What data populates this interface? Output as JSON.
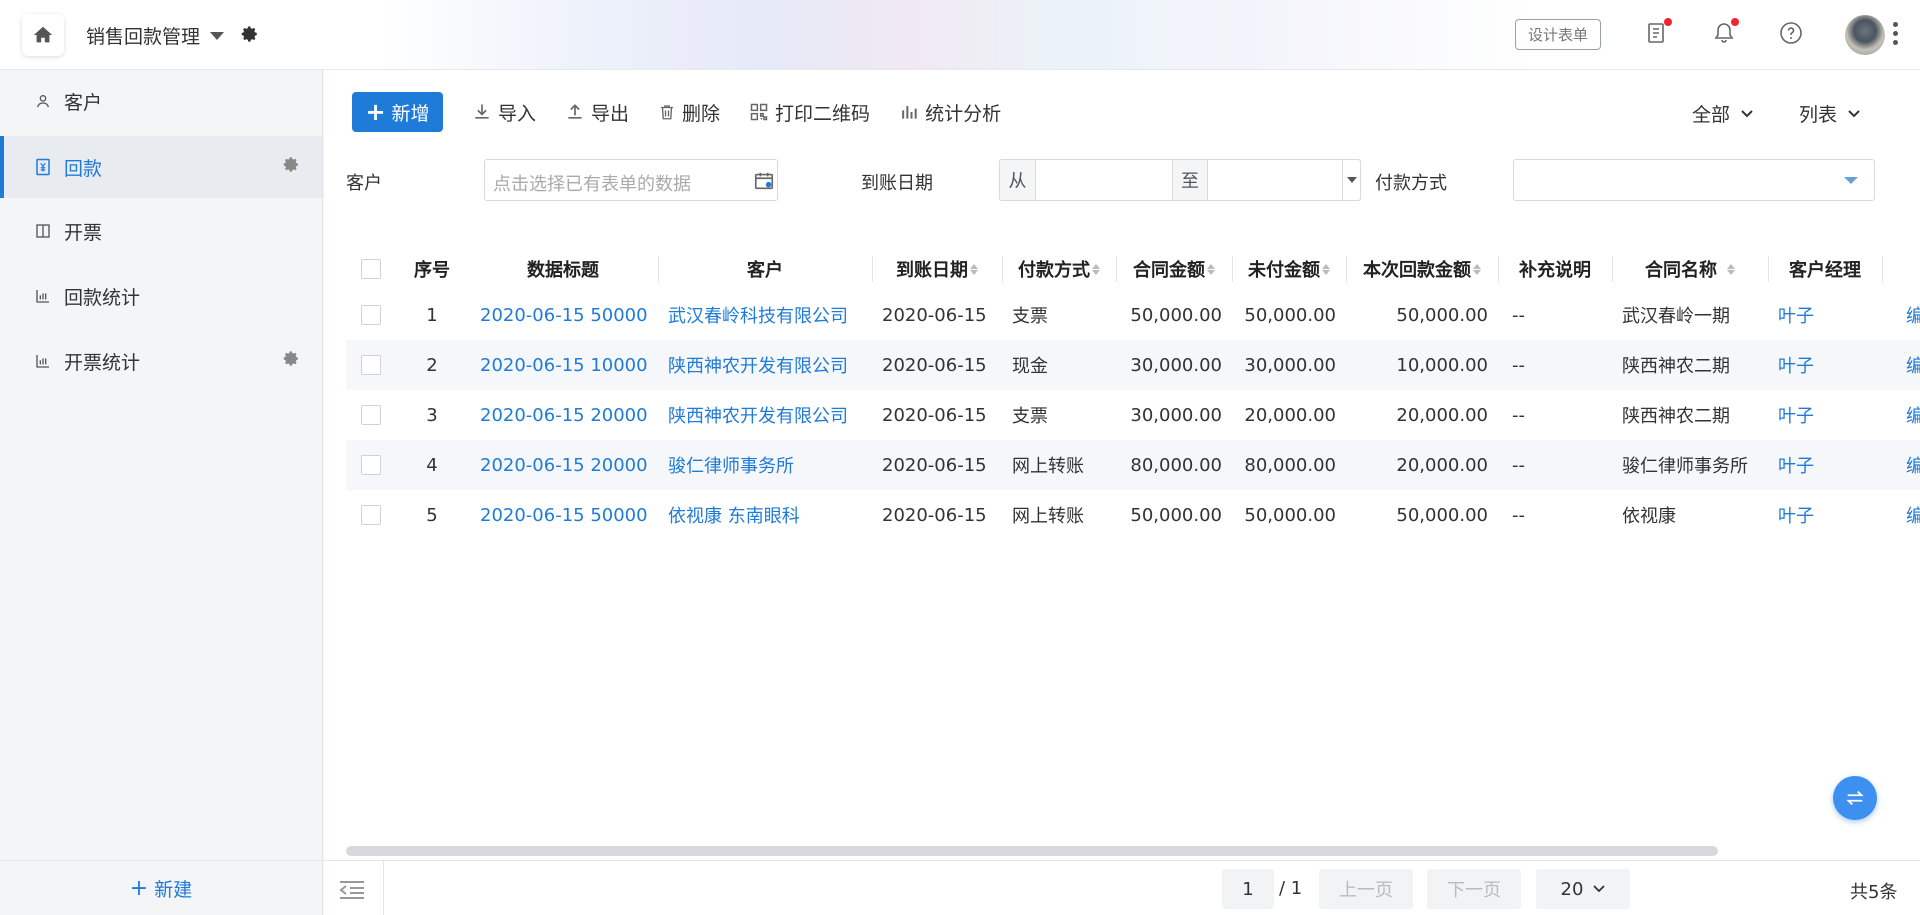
{
  "header": {
    "app_title": "销售回款管理",
    "design_form_label": "设计表单",
    "icons": [
      "home-icon",
      "gear-icon",
      "task-icon",
      "bell-icon",
      "help-icon"
    ],
    "accent_color": "#1f7bd8",
    "badge_color": "#f5222d"
  },
  "sidebar": {
    "items": [
      {
        "label": "客户",
        "icon": "person-icon"
      },
      {
        "label": "回款",
        "icon": "yen-doc-icon"
      },
      {
        "label": "开票",
        "icon": "invoice-icon"
      },
      {
        "label": "回款统计",
        "icon": "bar-chart-icon"
      },
      {
        "label": "开票统计",
        "icon": "bar-chart-icon"
      }
    ],
    "active_item": "回款",
    "new_label": "新建"
  },
  "toolbar": {
    "add_label": "新增",
    "import_label": "导入",
    "export_label": "导出",
    "delete_label": "删除",
    "print_qr_label": "打印二维码",
    "stats_label": "统计分析",
    "filter_scope": "全部",
    "view_mode": "列表"
  },
  "filters": {
    "customer_label": "客户",
    "customer_placeholder": "点击选择已有表单的数据",
    "date_label": "到账日期",
    "date_from": "从",
    "date_to": "至",
    "payment_label": "付款方式"
  },
  "table": {
    "columns": [
      "序号",
      "数据标题",
      "客户",
      "到账日期",
      "付款方式",
      "合同金额",
      "未付金额",
      "本次回款金额",
      "补充说明",
      "合同名称",
      "客户经理"
    ],
    "rows": [
      {
        "no": "1",
        "title": "2020-06-15 50000",
        "customer": "武汉春岭科技有限公司",
        "date": "2020-06-15",
        "method": "支票",
        "contract": "50,000.00",
        "unpaid": "50,000.00",
        "paid": "50,000.00",
        "note": "--",
        "contract_name": "武汉春岭一期",
        "manager": "叶子",
        "more": "编"
      },
      {
        "no": "2",
        "title": "2020-06-15 10000",
        "customer": "陕西神农开发有限公司",
        "date": "2020-06-15",
        "method": "现金",
        "contract": "30,000.00",
        "unpaid": "30,000.00",
        "paid": "10,000.00",
        "note": "--",
        "contract_name": "陕西神农二期",
        "manager": "叶子",
        "more": "编"
      },
      {
        "no": "3",
        "title": "2020-06-15 20000",
        "customer": "陕西神农开发有限公司",
        "date": "2020-06-15",
        "method": "支票",
        "contract": "30,000.00",
        "unpaid": "20,000.00",
        "paid": "20,000.00",
        "note": "--",
        "contract_name": "陕西神农二期",
        "manager": "叶子",
        "more": "编"
      },
      {
        "no": "4",
        "title": "2020-06-15 20000",
        "customer": "骏仁律师事务所",
        "date": "2020-06-15",
        "method": "网上转账",
        "contract": "80,000.00",
        "unpaid": "80,000.00",
        "paid": "20,000.00",
        "note": "--",
        "contract_name": "骏仁律师事务所",
        "manager": "叶子",
        "more": "编"
      },
      {
        "no": "5",
        "title": "2020-06-15 50000",
        "customer": "依视康 东南眼科",
        "date": "2020-06-15",
        "method": "网上转账",
        "contract": "50,000.00",
        "unpaid": "50,000.00",
        "paid": "50,000.00",
        "note": "--",
        "contract_name": "依视康",
        "manager": "叶子",
        "more": "编"
      }
    ]
  },
  "pagination": {
    "current_page": "1",
    "total_pages": "/ 1",
    "prev_label": "上一页",
    "next_label": "下一页",
    "page_size": "20",
    "total_label": "共5条"
  }
}
